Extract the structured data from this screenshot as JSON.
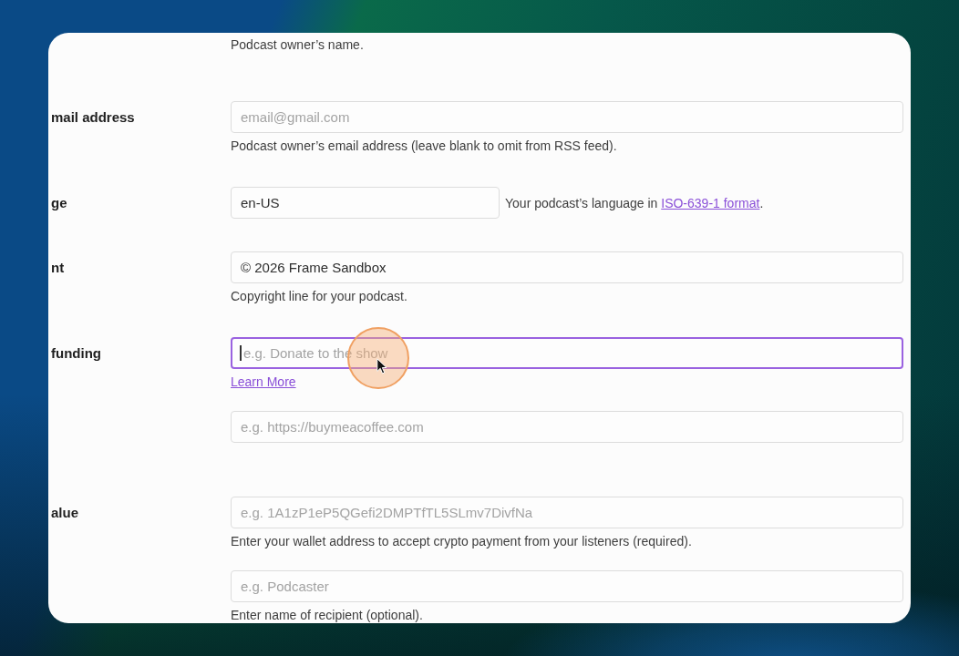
{
  "form": {
    "rows": [
      {
        "fields": [
          {
            "kind": "hint-only",
            "hint": [
              {
                "kind": "text",
                "text": "Podcast owner’s name."
              }
            ]
          }
        ]
      },
      {
        "label": "mail address",
        "fields": [
          {
            "kind": "full",
            "placeholder": "email@gmail.com",
            "focused": false,
            "hint": [
              {
                "kind": "text",
                "text": "Podcast owner’s email address (leave blank to omit from RSS feed)."
              }
            ]
          }
        ]
      },
      {
        "label": "ge",
        "fields": [
          {
            "kind": "short",
            "value": "en-US",
            "focused": false,
            "hint": [
              {
                "kind": "text",
                "text": "Your podcast’s language in "
              },
              {
                "kind": "link",
                "text": "ISO-639-1 format"
              },
              {
                "kind": "text",
                "text": "."
              }
            ]
          }
        ]
      },
      {
        "label": "nt",
        "fields": [
          {
            "kind": "full",
            "value": "© 2026 Frame Sandbox",
            "focused": false,
            "hint": [
              {
                "kind": "text",
                "text": "Copyright line for your podcast."
              }
            ]
          }
        ]
      },
      {
        "label": "funding",
        "fields": [
          {
            "kind": "full",
            "placeholder": "e.g. Donate to the show",
            "focused": true,
            "pointer": {
              "click_highlight": true
            },
            "hint": [
              {
                "kind": "link",
                "text": "Learn More"
              }
            ]
          },
          {
            "kind": "full",
            "placeholder": "e.g. https://buymeacoffee.com",
            "focused": false
          }
        ]
      },
      {
        "label": "alue",
        "fields": [
          {
            "kind": "full",
            "placeholder": "e.g. 1A1zP1eP5QGefi2DMPTfTL5SLmv7DivfNa",
            "focused": false,
            "hint": [
              {
                "kind": "text",
                "text": "Enter your wallet address to accept crypto payment from your listeners (required)."
              }
            ]
          },
          {
            "kind": "full",
            "placeholder": "e.g. Podcaster",
            "focused": false,
            "hint": [
              {
                "kind": "text",
                "text": "Enter name of recipient (optional)."
              }
            ]
          }
        ]
      }
    ]
  }
}
